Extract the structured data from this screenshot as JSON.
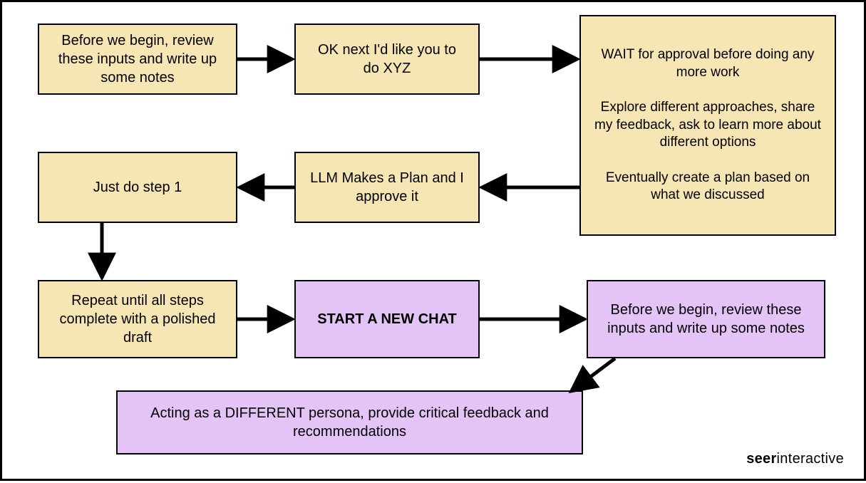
{
  "nodes": {
    "step1": "Before we begin, review these inputs and write up some notes",
    "step2": "OK next I'd like you to do XYZ",
    "step3": "WAIT for approval before doing any more work\n\nExplore different approaches, share my feedback, ask to learn more about different options\n\nEventually create a plan based on what we discussed",
    "plan": "LLM Makes a Plan and I approve it",
    "do1": "Just do step 1",
    "repeat": "Repeat until all steps complete with a polished draft",
    "newchat": "START A NEW CHAT",
    "again": "Before we begin, review these inputs and write up some notes",
    "persona": "Acting as a DIFFERENT persona, provide critical feedback and recommendations"
  },
  "brand": {
    "bold": "seer",
    "rest": "interactive"
  },
  "colors": {
    "cream": "#f6e6b4",
    "purple": "#e4c3f6"
  }
}
